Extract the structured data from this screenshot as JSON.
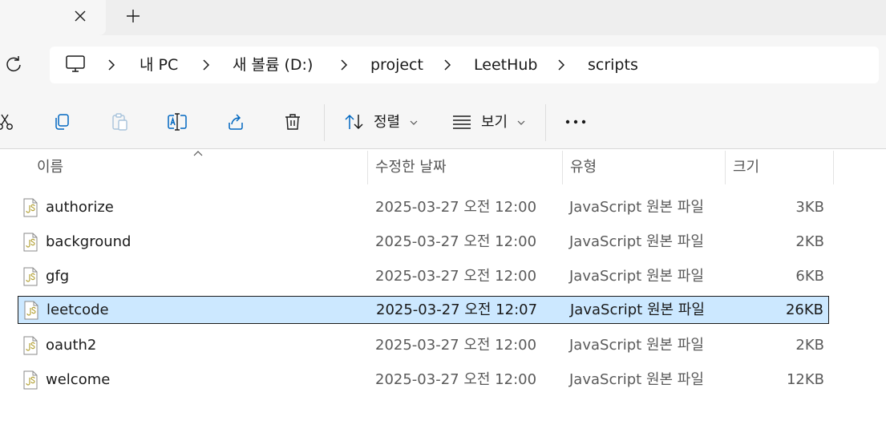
{
  "tabs": {
    "close_glyph": "✕",
    "new_tab_glyph": "+"
  },
  "breadcrumb": {
    "items": [
      "내 PC",
      "새 볼륨 (D:)",
      "project",
      "LeetHub",
      "scripts"
    ]
  },
  "toolbar": {
    "sort_label": "정렬",
    "view_label": "보기",
    "more_glyph": "•••",
    "icons": [
      "cut-icon",
      "copy-icon",
      "paste-icon",
      "rename-icon",
      "share-icon",
      "delete-icon",
      "sort-icon",
      "view-icon",
      "more-icon"
    ]
  },
  "columns": {
    "name": "이름",
    "date": "수정한 날짜",
    "type": "유형",
    "size": "크기"
  },
  "files": [
    {
      "name": "authorize",
      "date": "2025-03-27 오전 12:00",
      "type": "JavaScript 원본 파일",
      "size": "3KB",
      "selected": false
    },
    {
      "name": "background",
      "date": "2025-03-27 오전 12:00",
      "type": "JavaScript 원본 파일",
      "size": "2KB",
      "selected": false
    },
    {
      "name": "gfg",
      "date": "2025-03-27 오전 12:00",
      "type": "JavaScript 원본 파일",
      "size": "6KB",
      "selected": false
    },
    {
      "name": "leetcode",
      "date": "2025-03-27 오전 12:07",
      "type": "JavaScript 원본 파일",
      "size": "26KB",
      "selected": true
    },
    {
      "name": "oauth2",
      "date": "2025-03-27 오전 12:00",
      "type": "JavaScript 원본 파일",
      "size": "2KB",
      "selected": false
    },
    {
      "name": "welcome",
      "date": "2025-03-27 오전 12:00",
      "type": "JavaScript 원본 파일",
      "size": "12KB",
      "selected": false
    }
  ],
  "colors": {
    "accent": "#0067c0",
    "selection": "#cce8ff",
    "js_icon": "#b5a33a"
  }
}
